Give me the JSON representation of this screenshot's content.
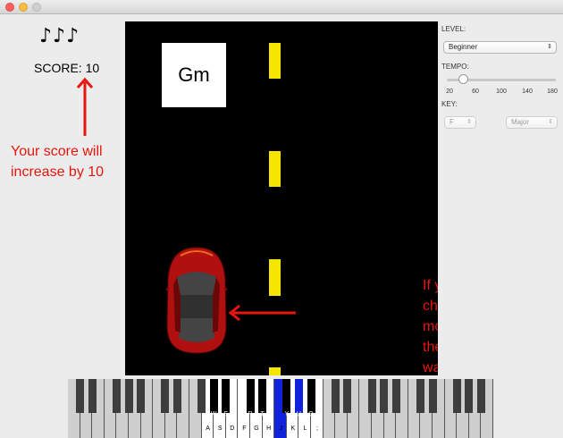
{
  "window": {
    "buttons": [
      "close",
      "minimize",
      "maximize"
    ]
  },
  "left": {
    "notes": "♪♪♪",
    "score_label": "SCORE: 10",
    "annotation": "Your score will increase by 10",
    "arrow_color": "#e8150c"
  },
  "road": {
    "chord": "Gm",
    "car_color": "#b01010",
    "annotation": "If you play the correct chord the car will move to the side of the road the chord was on",
    "lane_color": "#f5e500"
  },
  "controls": {
    "level_label": "LEVEL:",
    "level_value": "Beginner",
    "tempo_label": "TEMPO:",
    "tempo_value": 60,
    "tempo_ticks": [
      "20",
      "60",
      "100",
      "140",
      "180"
    ],
    "key_label": "KEY:",
    "key_value": "F",
    "mode_value": "Major"
  },
  "piano": {
    "white_labels": [
      "A",
      "S",
      "D",
      "F",
      "G",
      "H",
      "J",
      "K",
      "L",
      ";"
    ],
    "black_labels": [
      "W",
      "E",
      "R",
      "T",
      "Y",
      "U",
      "O",
      "P"
    ],
    "highlight_color": "#1122dd"
  }
}
